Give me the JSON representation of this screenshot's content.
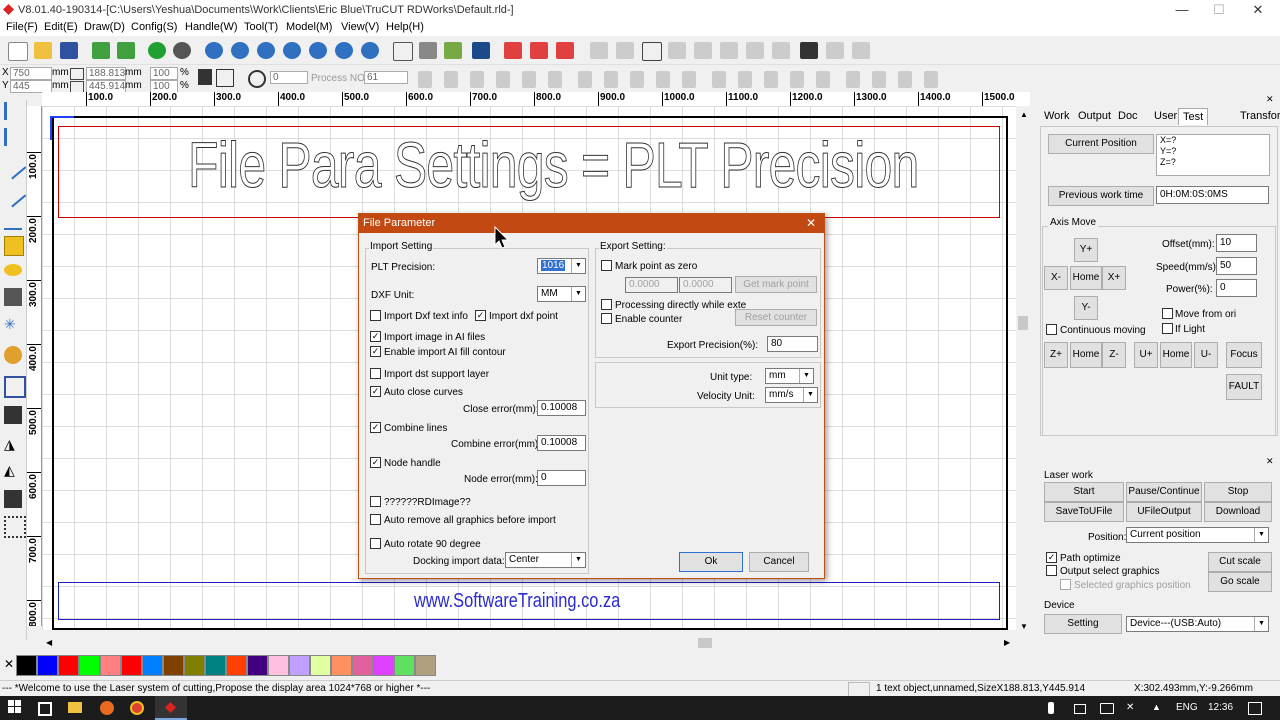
{
  "window": {
    "title": "V8.01.40-190314-[C:\\Users\\Yeshua\\Documents\\Work\\Clients\\Eric Blue\\TruCUT RDWorks\\Default.rld-]",
    "minimize": "—",
    "maximize": "☐",
    "close": "✕"
  },
  "menu": [
    "File(F)",
    "Edit(E)",
    "Draw(D)",
    "Config(S)",
    "Handle(W)",
    "Tool(T)",
    "Model(M)",
    "View(V)",
    "Help(H)"
  ],
  "coords": {
    "x_label": "X",
    "x_value": "750",
    "x_unit": "mm",
    "y_label": "Y",
    "y_value": "445",
    "y_unit": "mm",
    "w_value": "188.813",
    "w_unit": "mm",
    "h_value": "445.914",
    "h_unit": "mm",
    "pct1": "100",
    "pct2": "100",
    "pct_unit": "%",
    "rotate_value": "0",
    "process_no_label": "Process NO:",
    "process_no_value": "61"
  },
  "ruler": {
    "h_ticks": [
      "100.0",
      "200.0",
      "300.0",
      "400.0",
      "500.0",
      "600.0",
      "700.0",
      "800.0",
      "900.0",
      "1000.0",
      "1100.0",
      "1200.0",
      "1300.0",
      "1400.0",
      "1500.0"
    ],
    "v_ticks": [
      "100.0",
      "200.0",
      "300.0",
      "400.0",
      "500.0",
      "600.0",
      "700.0",
      "800.0"
    ]
  },
  "canvas": {
    "heading": "File Para Settings = PLT Precision",
    "footer": "www.SoftwareTraining.co.za"
  },
  "palette": [
    "#000000",
    "#0000ff",
    "#ff0000",
    "#00ff00",
    "#ff8080",
    "#ff0000",
    "#0080ff",
    "#804000",
    "#808000",
    "#008080",
    "#ff4000",
    "#400080",
    "#ffc0e0",
    "#c0a0ff",
    "#e0ffa0",
    "#ff9060",
    "#e060a0",
    "#e040ff",
    "#60e060",
    "#b0a080"
  ],
  "status": {
    "welcome": "--- *Welcome to use the Laser system of cutting,Propose the display area 1024*768 or higher *---",
    "selection": "1 text object,unnamed,SizeX188.813,Y445.914",
    "cursor": "X:302.493mm,Y:-9.266mm"
  },
  "taskbar": {
    "lang": "ENG",
    "time": "12:36"
  },
  "right_panel": {
    "tabs": [
      "Work",
      "Output",
      "Doc",
      "User",
      "Test",
      "Transform"
    ],
    "current_position_btn": "Current Position",
    "pos_lines": [
      "X=?",
      "Y=?",
      "Z=?"
    ],
    "prev_work_time_btn": "Previous work time",
    "prev_work_time_value": "0H:0M:0S:0MS",
    "axis_move_title": "Axis Move",
    "y_plus": "Y+",
    "x_minus": "X-",
    "home": "Home",
    "x_plus": "X+",
    "y_minus": "Y-",
    "offset_label": "Offset(mm):",
    "offset_value": "10",
    "speed_label": "Speed(mm/s):",
    "speed_value": "50",
    "power_label": "Power(%):",
    "power_value": "0",
    "move_from_origin": "Move from ori",
    "if_light": "If Light",
    "continuous_moving": "Continuous moving",
    "z_plus": "Z+",
    "z_minus": "Z-",
    "u_plus": "U+",
    "u_minus": "U-",
    "focus": "Focus",
    "fault": "FAULT"
  },
  "laser_work": {
    "title": "Laser work",
    "start": "Start",
    "pause": "Pause/Continue",
    "stop": "Stop",
    "save_to_ufile": "SaveToUFile",
    "ufile_output": "UFileOutput",
    "download": "Download",
    "position_label": "Position:",
    "position_value": "Current position",
    "path_optimize": "Path optimize",
    "output_select": "Output select graphics",
    "selected_position": "Selected graphics position",
    "cut_scale": "Cut scale",
    "go_scale": "Go scale",
    "device_title": "Device",
    "setting": "Setting",
    "device_value": "Device---(USB:Auto)"
  },
  "dialog": {
    "title": "File Parameter",
    "import_setting": "Import Setting",
    "plt_precision_label": "PLT Precision:",
    "plt_precision_value": "1016",
    "dxf_unit_label": "DXF Unit:",
    "dxf_unit_value": "MM",
    "import_dxf_text": "Import Dxf text info",
    "import_dxf_point": "Import dxf point",
    "import_image_ai": "Import image in AI files",
    "enable_ai_fill": "Enable import AI fill contour",
    "import_dst": "Import dst support layer",
    "auto_close": "Auto close curves",
    "close_error_label": "Close error(mm):",
    "close_error_value": "0.10008",
    "combine_lines": "Combine lines",
    "combine_error_label": "Combine error(mm):",
    "combine_error_value": "0.10008",
    "node_handle": "Node handle",
    "node_error_label": "Node error(mm):",
    "node_error_value": "0",
    "rd_image": "??????RDImage??",
    "auto_remove": "Auto remove all graphics before import",
    "auto_rotate": "Auto rotate 90 degree",
    "docking_label": "Docking import data:",
    "docking_value": "Center",
    "export_setting": "Export Setting:",
    "mark_point_zero": "Mark point as zero",
    "mark_x": "0.0000",
    "mark_y": "0.0000",
    "get_mark_point": "Get mark point",
    "process_directly": "Processing directly while exte",
    "enable_counter": "Enable counter",
    "reset_counter": "Reset counter",
    "export_precision_label": "Export Precision(%):",
    "export_precision_value": "80",
    "unit_type_label": "Unit type:",
    "unit_type_value": "mm",
    "velocity_unit_label": "Velocity Unit:",
    "velocity_unit_value": "mm/s",
    "ok": "Ok",
    "cancel": "Cancel",
    "close": "✕"
  }
}
